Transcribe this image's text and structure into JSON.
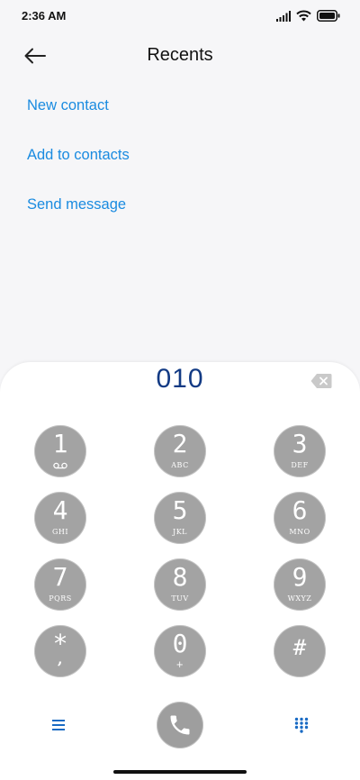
{
  "status_bar": {
    "time": "2:36 AM",
    "icons": [
      "signal-icon",
      "wifi-icon",
      "battery-icon"
    ]
  },
  "header": {
    "title": "Recents",
    "back_icon": "back-arrow-icon"
  },
  "actions": [
    {
      "label": "New contact"
    },
    {
      "label": "Add to contacts"
    },
    {
      "label": "Send message"
    }
  ],
  "dialer": {
    "number": "010",
    "backspace_icon": "backspace-icon",
    "keys": [
      {
        "digit": "1",
        "letters": ""
      },
      {
        "digit": "2",
        "letters": "ABC"
      },
      {
        "digit": "3",
        "letters": "DEF"
      },
      {
        "digit": "4",
        "letters": "GHI"
      },
      {
        "digit": "5",
        "letters": "JKL"
      },
      {
        "digit": "6",
        "letters": "MNO"
      },
      {
        "digit": "7",
        "letters": "PQRS"
      },
      {
        "digit": "8",
        "letters": "TUV"
      },
      {
        "digit": "9",
        "letters": "WXYZ"
      },
      {
        "digit": "*",
        "letters": ","
      },
      {
        "digit": "0",
        "letters": "+"
      },
      {
        "digit": "#",
        "letters": ""
      }
    ]
  },
  "bottom_bar": {
    "menu_icon": "menu-icon",
    "call_icon": "phone-icon",
    "keypad_icon": "dialpad-icon"
  },
  "colors": {
    "accent": "#1a8be0",
    "number": "#123a84",
    "key": "#a3a3a3"
  }
}
